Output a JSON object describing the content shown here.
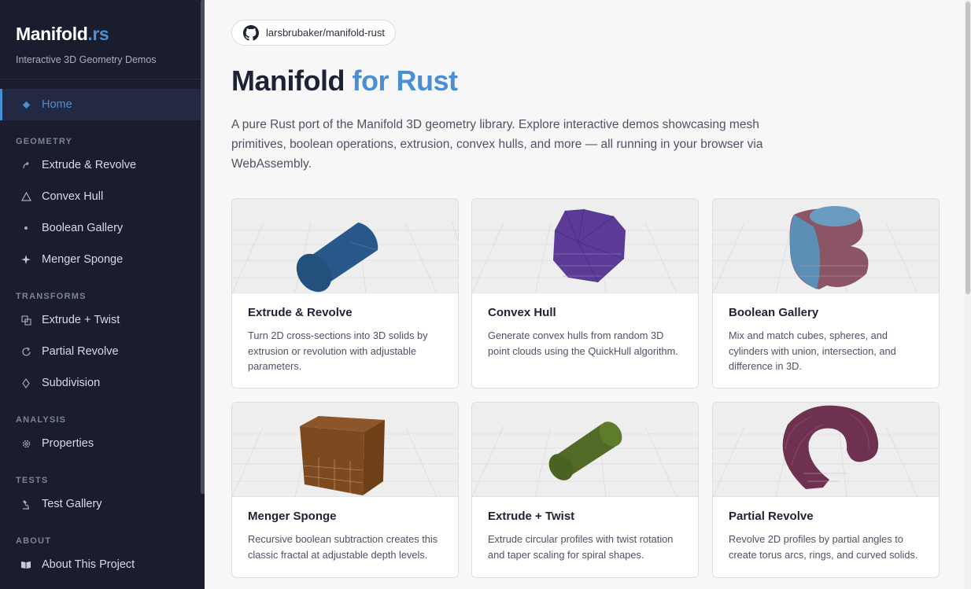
{
  "brand": {
    "name": "Manifold",
    "suffix": ".rs",
    "subtitle": "Interactive 3D Geometry Demos"
  },
  "nav": {
    "home": {
      "label": "Home",
      "icon": "diamond-icon"
    },
    "sections": [
      {
        "title": "GEOMETRY",
        "items": [
          {
            "label": "Extrude & Revolve",
            "icon": "curve-arrow-icon"
          },
          {
            "label": "Convex Hull",
            "icon": "triangle-icon"
          },
          {
            "label": "Boolean Gallery",
            "icon": "dot-icon"
          },
          {
            "label": "Menger Sponge",
            "icon": "sparkle-icon"
          }
        ]
      },
      {
        "title": "TRANSFORMS",
        "items": [
          {
            "label": "Extrude + Twist",
            "icon": "overlap-squares-icon"
          },
          {
            "label": "Partial Revolve",
            "icon": "rotate-icon"
          },
          {
            "label": "Subdivision",
            "icon": "diamond-outline-icon"
          }
        ]
      },
      {
        "title": "ANALYSIS",
        "items": [
          {
            "label": "Properties",
            "icon": "gear-icon"
          }
        ]
      },
      {
        "title": "TESTS",
        "items": [
          {
            "label": "Test Gallery",
            "icon": "microscope-icon"
          }
        ]
      },
      {
        "title": "ABOUT",
        "items": [
          {
            "label": "About This Project",
            "icon": "book-icon"
          }
        ]
      }
    ]
  },
  "repo": {
    "label": "larsbrubaker/manifold-rust",
    "icon": "github-icon"
  },
  "hero": {
    "title": "Manifold",
    "title_accent": "for Rust",
    "description": "A pure Rust port of the Manifold 3D geometry library. Explore interactive demos showcasing mesh primitives, boolean operations, extrusion, convex hulls, and more — all running in your browser via WebAssembly."
  },
  "cards": [
    {
      "title": "Extrude & Revolve",
      "description": "Turn 2D cross-sections into 3D solids by extrusion or revolution with adjustable parameters.",
      "color": "#275889"
    },
    {
      "title": "Convex Hull",
      "description": "Generate convex hulls from random 3D point clouds using the QuickHull algorithm.",
      "color": "#5b3b96"
    },
    {
      "title": "Boolean Gallery",
      "description": "Mix and match cubes, spheres, and cylinders with union, intersection, and difference in 3D.",
      "color": "#5b8fb5"
    },
    {
      "title": "Menger Sponge",
      "description": "Recursive boolean subtraction creates this classic fractal at adjustable depth levels.",
      "color": "#7d4a1f"
    },
    {
      "title": "Extrude + Twist",
      "description": "Extrude circular profiles with twist rotation and taper scaling for spiral shapes.",
      "color": "#516b26"
    },
    {
      "title": "Partial Revolve",
      "description": "Revolve 2D profiles by partial angles to create torus arcs, rings, and curved solids.",
      "color": "#6e3150"
    }
  ],
  "colors": {
    "sidebar_bg": "#1a1d2e",
    "accent": "#4a8fd4",
    "page_bg": "#f7f7f8"
  }
}
